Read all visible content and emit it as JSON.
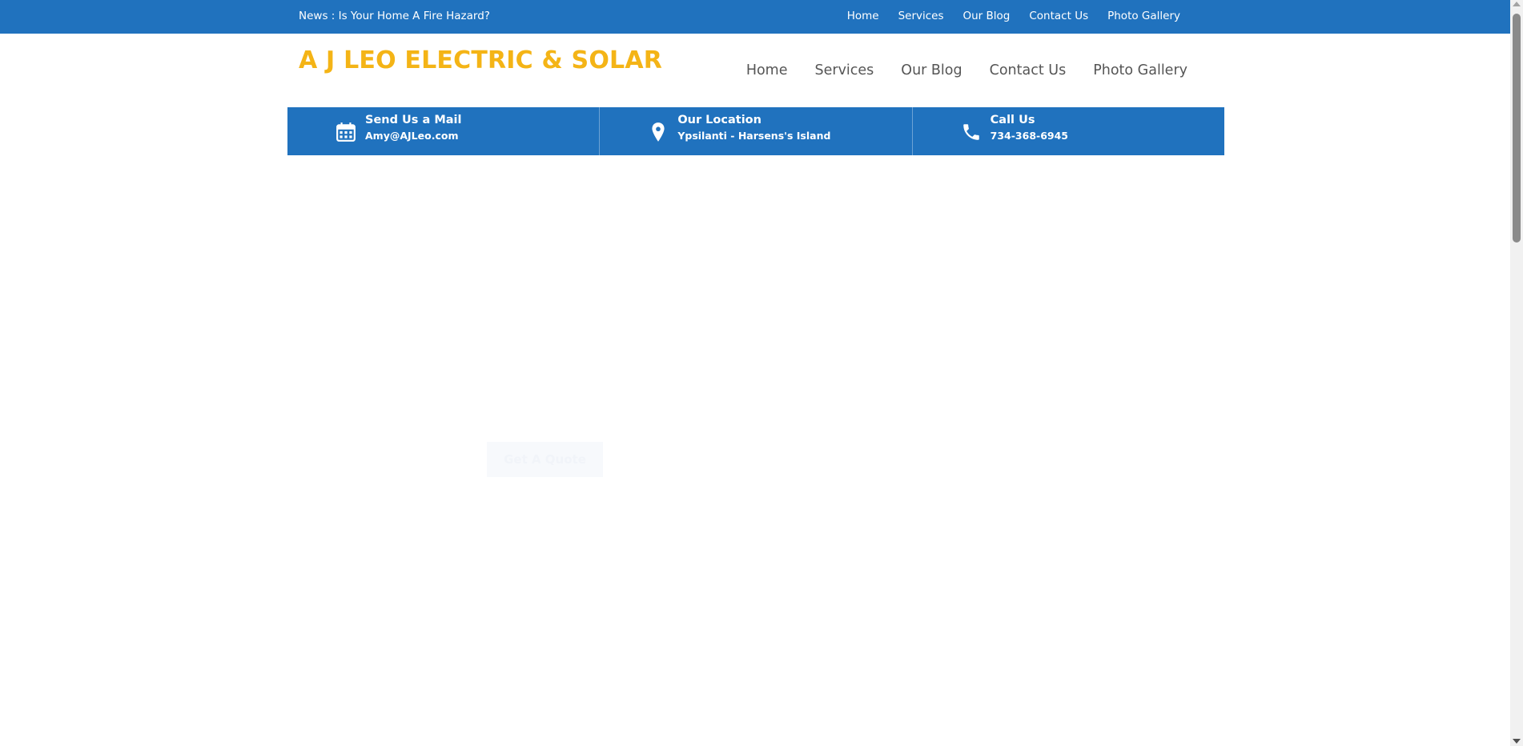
{
  "topbar": {
    "news": "News : Is Your Home A Fire Hazard?",
    "links": [
      "Home",
      "Services",
      "Our Blog",
      "Contact Us",
      "Photo Gallery"
    ]
  },
  "header": {
    "logo": "A J LEO ELECTRIC & SOLAR",
    "nav": [
      "Home",
      "Services",
      "Our Blog",
      "Contact Us",
      "Photo Gallery"
    ]
  },
  "info": [
    {
      "icon": "calendar-icon",
      "title": "Send Us a Mail",
      "value": "Amy@AJLeo.com"
    },
    {
      "icon": "location-pin-icon",
      "title": "Our Location",
      "value": "Ypsilanti - Harsens's Island"
    },
    {
      "icon": "phone-icon",
      "title": "Call Us",
      "value": "734-368-6945"
    }
  ],
  "hero": {
    "button": "Get A Quote"
  },
  "colors": {
    "brand_blue": "#2072be",
    "logo_gold": "#f4b416"
  }
}
